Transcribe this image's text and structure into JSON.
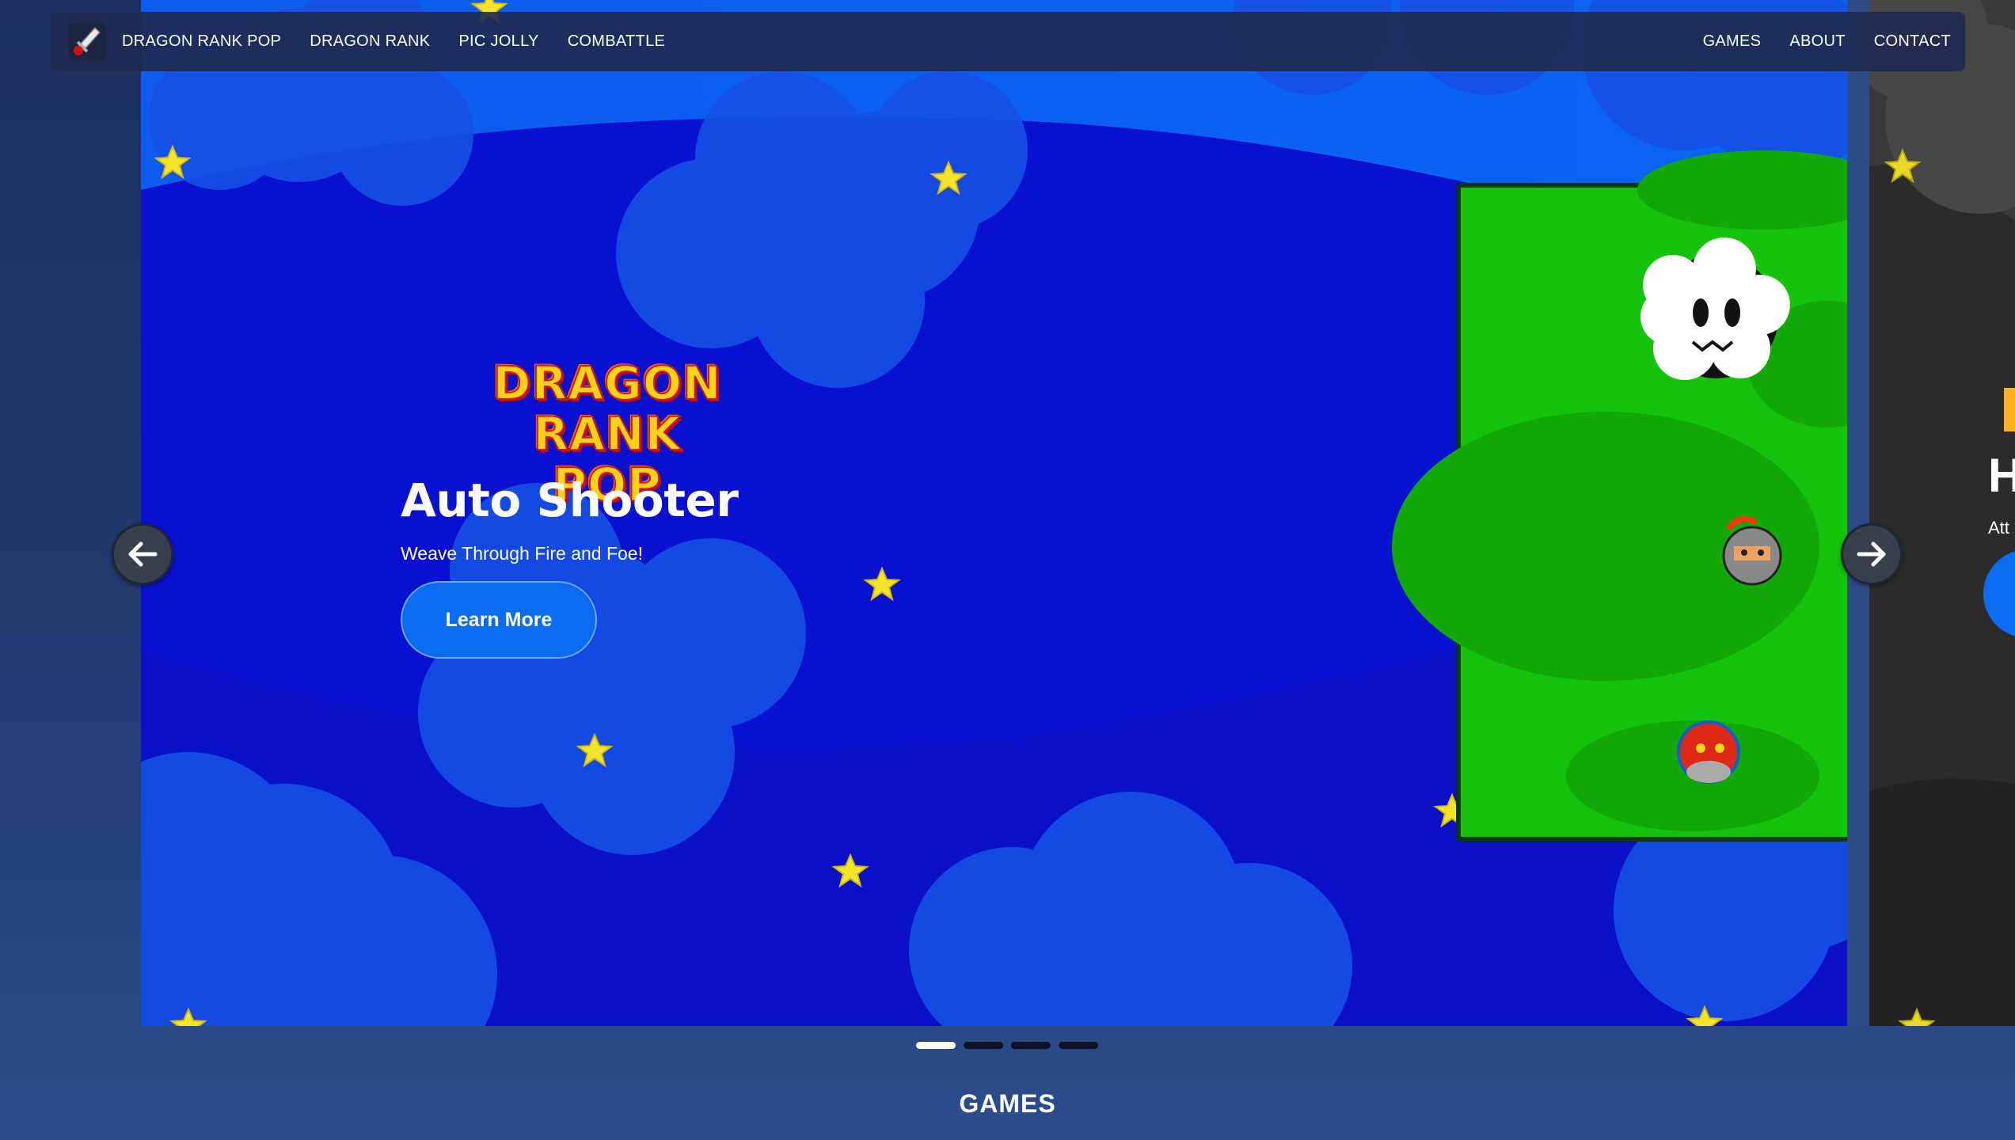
{
  "navbar": {
    "left_links": [
      "DRAGON RANK POP",
      "DRAGON RANK",
      "PIC JOLLY",
      "COMBATTLE"
    ],
    "right_links": [
      "GAMES",
      "ABOUT",
      "CONTACT"
    ],
    "logo_icon": "sword-logo-icon"
  },
  "hero": {
    "logo_line1": "DRAGON RANK",
    "logo_line2": "POP",
    "title": "Auto Shooter",
    "subtitle": "Weave Through Fire and Foe!",
    "button_label": "Learn More"
  },
  "next_slide": {
    "title_fragment": "H",
    "subtitle_fragment": "Att"
  },
  "carousel": {
    "slide_count": 4,
    "active_index": 0,
    "prev_icon": "arrow-left-icon",
    "next_icon": "arrow-right-icon"
  },
  "section": {
    "games_heading": "GAMES"
  },
  "colors": {
    "sky": "#0a1ad8",
    "cloud": "#1e5ee0",
    "grass": "#19c40a",
    "button": "#0a6cf0",
    "star": "#f5e52a"
  }
}
